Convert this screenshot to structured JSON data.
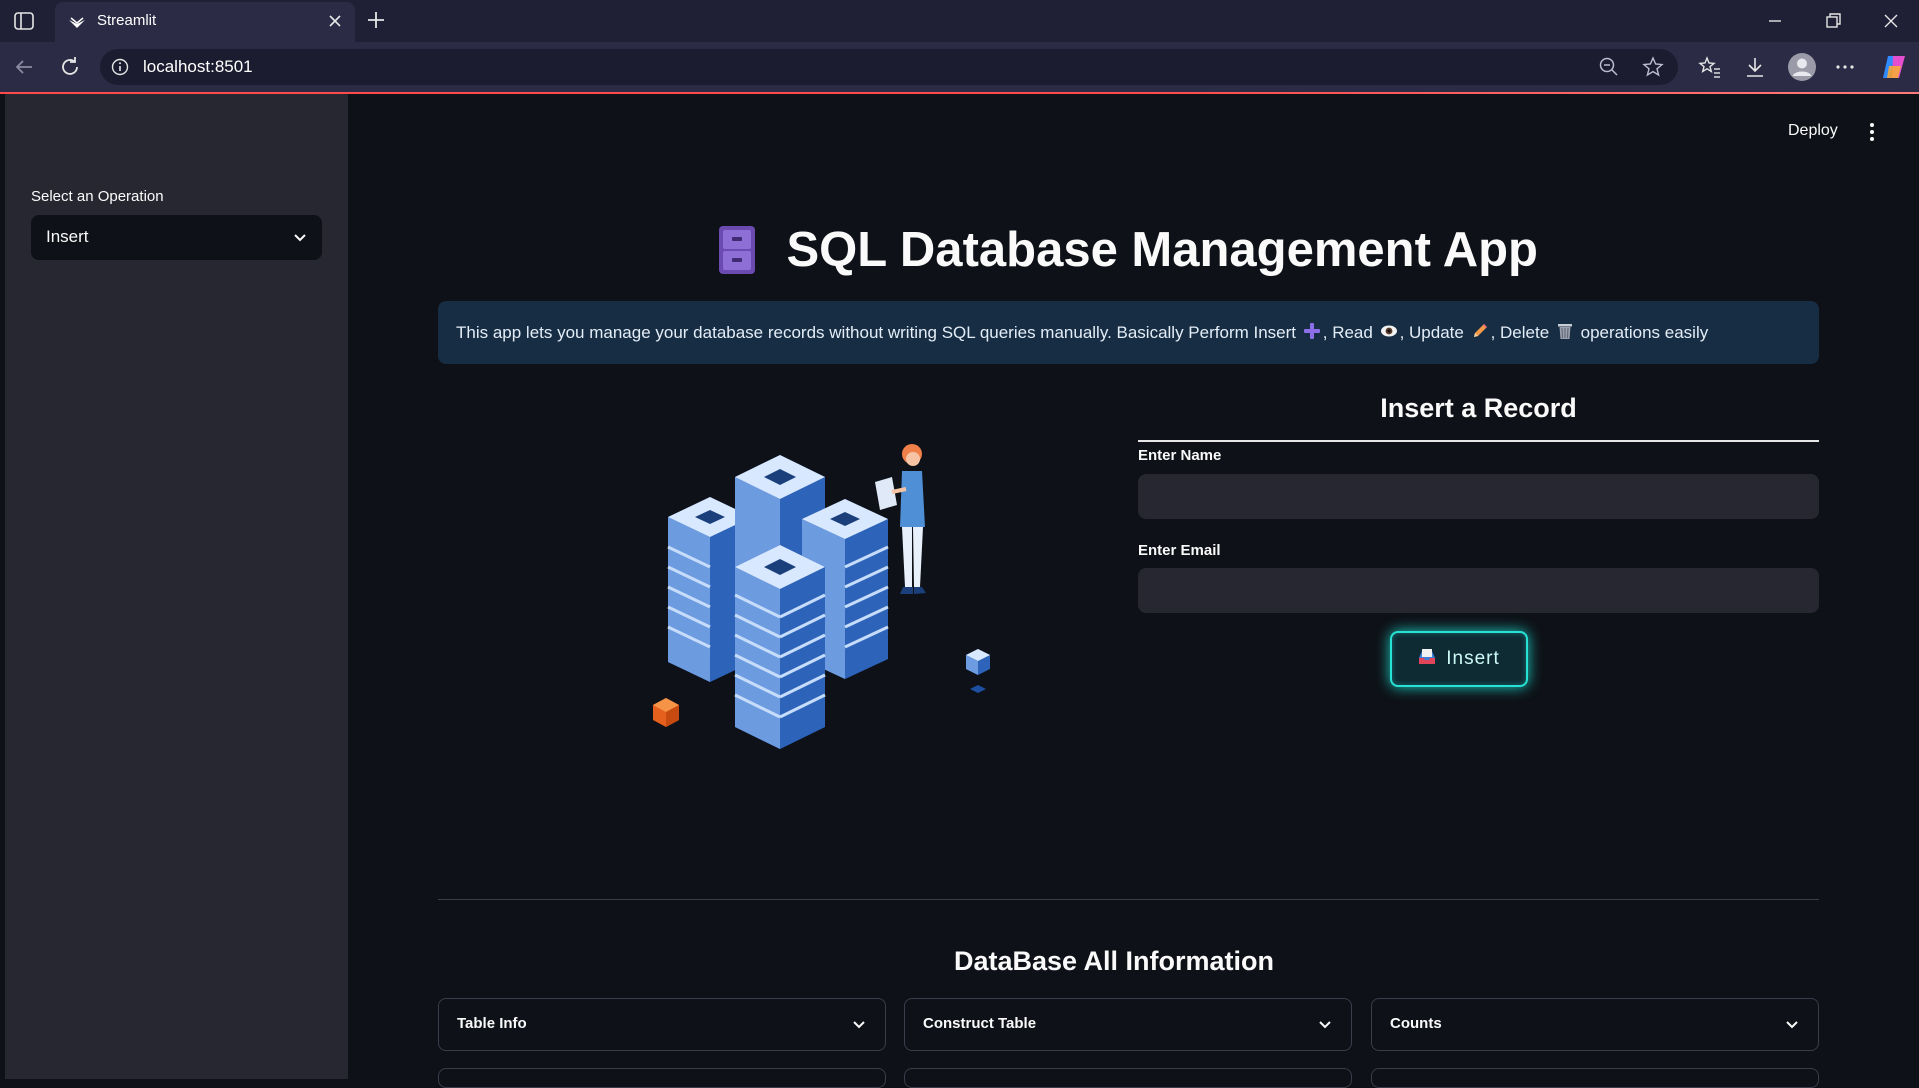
{
  "browser": {
    "tab_title": "Streamlit",
    "url": "localhost:8501"
  },
  "sidebar": {
    "select_label": "Select an Operation",
    "select_value": "Insert"
  },
  "header": {
    "deploy_label": "Deploy"
  },
  "main": {
    "title": "SQL Database Management App",
    "info": {
      "text_1": "This app lets you manage your database records without writing SQL queries manually. Basically Perform Insert",
      "text_2": ", Read",
      "text_3": ", Update",
      "text_4": ", Delete",
      "text_5": "operations easily"
    },
    "form": {
      "title": "Insert a Record",
      "name_label": "Enter Name",
      "name_value": "",
      "email_label": "Enter Email",
      "email_value": "",
      "insert_label": "Insert"
    },
    "section_title": "DataBase All Information",
    "expanders": [
      "Table Info",
      "Construct Table",
      "Counts"
    ]
  },
  "colors": {
    "background": "#0e1117",
    "sidebar": "#262730",
    "info_bg": "#172d43",
    "accent_glow": "#27e2d4",
    "browser_chrome": "#2b2b45"
  }
}
